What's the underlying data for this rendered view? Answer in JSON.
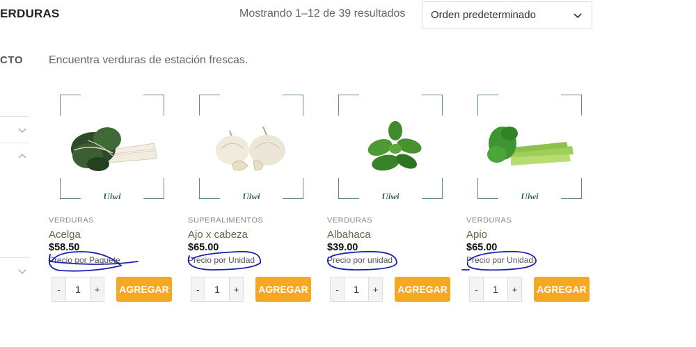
{
  "header": {
    "category_title": "ERDURAS",
    "results_text": "Mostrando 1–12 de 39 resultados",
    "sort_value": "Orden predeterminado"
  },
  "sidebar": {
    "heading": "CTO"
  },
  "category_description": "Encuentra verduras de estación frescas.",
  "brand_logo_text": "Uiwi",
  "annotation_color": "#1a1fb0",
  "accent_color": "#f7a823",
  "products": [
    {
      "category": "VERDURAS",
      "name": "Acelga",
      "price": "$58.50",
      "unit": "Precio por Paquete",
      "qty": "1",
      "minus": "-",
      "plus": "+",
      "add_label": "AGREGAR",
      "icon": "chard-image"
    },
    {
      "category": "SUPERALIMENTOS",
      "name": "Ajo x cabeza",
      "price": "$65.00",
      "unit": "Precio por Unidad",
      "qty": "1",
      "minus": "-",
      "plus": "+",
      "add_label": "AGREGAR",
      "icon": "garlic-image"
    },
    {
      "category": "VERDURAS",
      "name": "Albahaca",
      "price": "$39.00",
      "unit": "Precio por unidad",
      "qty": "1",
      "minus": "-",
      "plus": "+",
      "add_label": "AGREGAR",
      "icon": "basil-image"
    },
    {
      "category": "VERDURAS",
      "name": "Apio",
      "price": "$65.00",
      "unit": "Precio por Unidad",
      "qty": "1",
      "minus": "-",
      "plus": "+",
      "add_label": "AGREGAR",
      "icon": "celery-image"
    }
  ]
}
